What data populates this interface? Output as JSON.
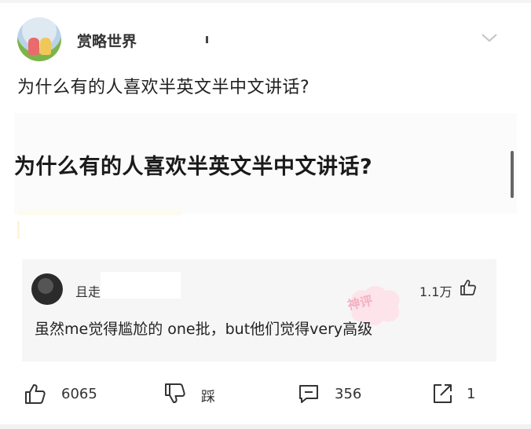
{
  "header": {
    "author_name": "赏略世界",
    "avatar_icon": "avatar-kids-picture",
    "more_icon": "chevron-down-icon"
  },
  "post": {
    "question": "为什么有的人喜欢半英文半中文讲话?",
    "embedded_title": "为什么有的人喜欢半英文半中文讲话?"
  },
  "comment": {
    "username": "且走",
    "likes": "1.1万",
    "text": "虽然me觉得尴尬的 one批，but他们觉得very高级",
    "badge": "神评"
  },
  "actions": {
    "like_count": "6065",
    "dislike_label": "踩",
    "comment_count": "356",
    "share_count": "1"
  }
}
